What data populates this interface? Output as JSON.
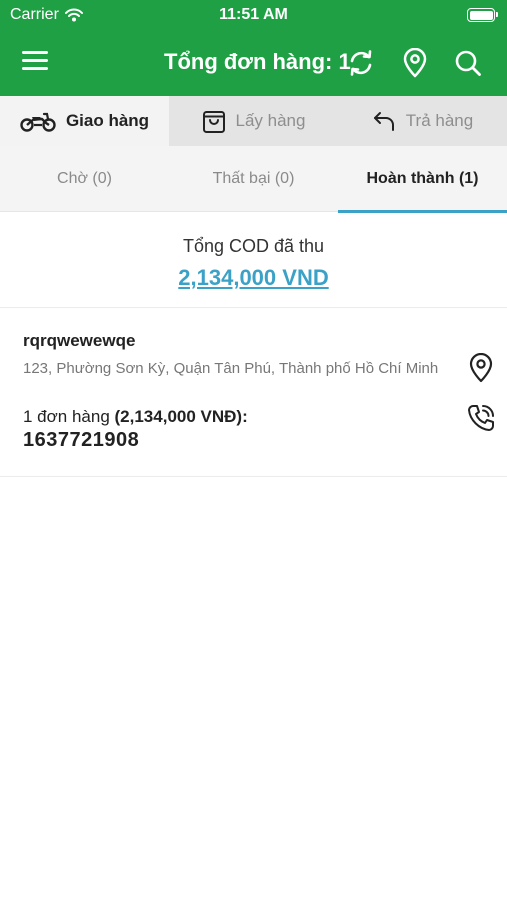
{
  "status_bar": {
    "carrier": "Carrier",
    "time": "11:51 AM"
  },
  "header": {
    "title": "Tổng đơn hàng: 1",
    "icons": [
      "menu-icon",
      "refresh-icon",
      "map-pin-icon",
      "search-icon"
    ]
  },
  "main_tabs": [
    {
      "label": "Giao hàng",
      "icon": "motorbike-icon",
      "active": true
    },
    {
      "label": "Lấy hàng",
      "icon": "shopping-bag-icon",
      "active": false
    },
    {
      "label": "Trả hàng",
      "icon": "return-arrow-icon",
      "active": false
    }
  ],
  "sub_tabs": [
    {
      "label": "Chờ (0)",
      "active": false
    },
    {
      "label": "Thất bại (0)",
      "active": false
    },
    {
      "label": "Hoàn thành (1)",
      "active": true
    }
  ],
  "cod": {
    "label": "Tổng COD đã thu",
    "value": "2,134,000 VND"
  },
  "orders": [
    {
      "name": "rqrqwewewqe",
      "address": "123, Phường Sơn Kỳ, Quận Tân Phú, Thành phố Hồ Chí Minh",
      "count_text": "1 đơn hàng",
      "amount_text": "(2,134,000 VNĐ):",
      "phone": "1637721908"
    }
  ],
  "colors": {
    "header_green": "#1fa045",
    "accent_blue": "#3ba1c6",
    "tab_bg": "#e4e4e4",
    "active_tab_bg": "#f3f3f3"
  }
}
